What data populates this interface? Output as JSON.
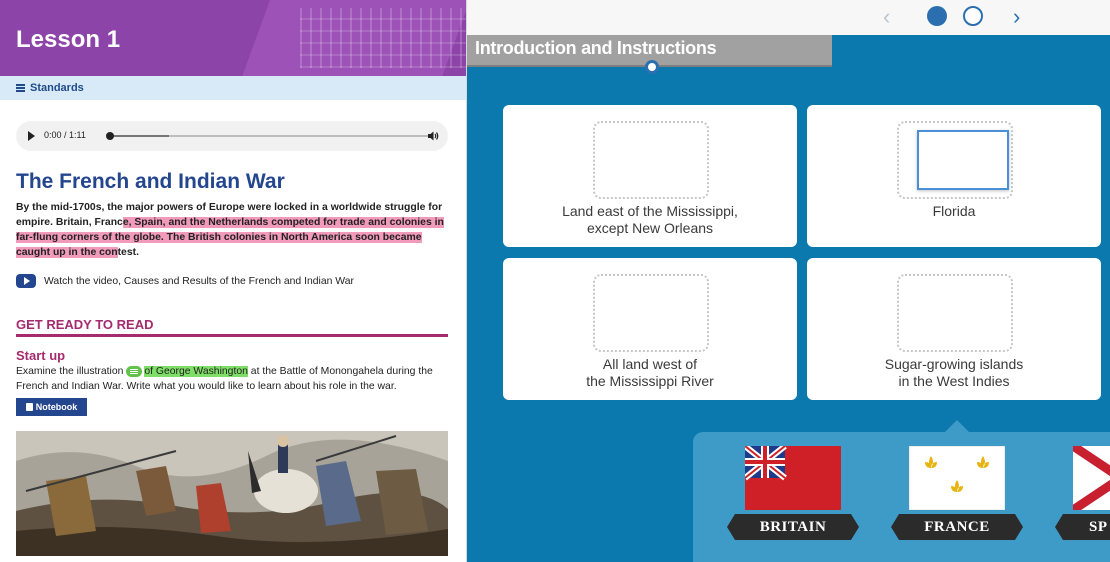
{
  "lesson": {
    "title": "Lesson 1",
    "standards_label": "Standards"
  },
  "audio": {
    "time": "0:00 / 1:11"
  },
  "article": {
    "heading": "The French and Indian War",
    "intro_plain": "By the mid-1700s, the major powers of Europe were locked in a worldwide struggle for empire. Britain, Franc",
    "intro_highlight": "e, Spain, and the Netherlands competed for trade and colonies in far-flung corners of the globe. The British colonies in North America soon became caught up in the con",
    "intro_end": "test.",
    "video_link": "Watch the video, Causes and Results of the French and Indian War"
  },
  "get_ready": {
    "heading": "GET READY TO READ",
    "subheading": "Start up",
    "text_before": "Examine the illustration ",
    "text_highlight": "of George Washington",
    "text_after": " at the Battle of Monongahela during the French and Indian War. Write what you would like to learn about his role in the war.",
    "notebook_label": "Notebook"
  },
  "activity": {
    "banner_title": "Introduction and Instructions",
    "cards": [
      {
        "label": "Land east of the Mississippi,\nexcept New Orleans"
      },
      {
        "label": "Florida"
      },
      {
        "label": "All land west of\nthe Mississippi River"
      },
      {
        "label": "Sugar-growing islands\nin the West Indies"
      }
    ],
    "flags": [
      {
        "label": "BRITAIN"
      },
      {
        "label": "FRANCE"
      },
      {
        "label": "SP"
      }
    ]
  },
  "colors": {
    "purple": "#8d44a8",
    "navy": "#24468f",
    "maroon": "#a52a6e",
    "teal": "#0b79ad"
  }
}
